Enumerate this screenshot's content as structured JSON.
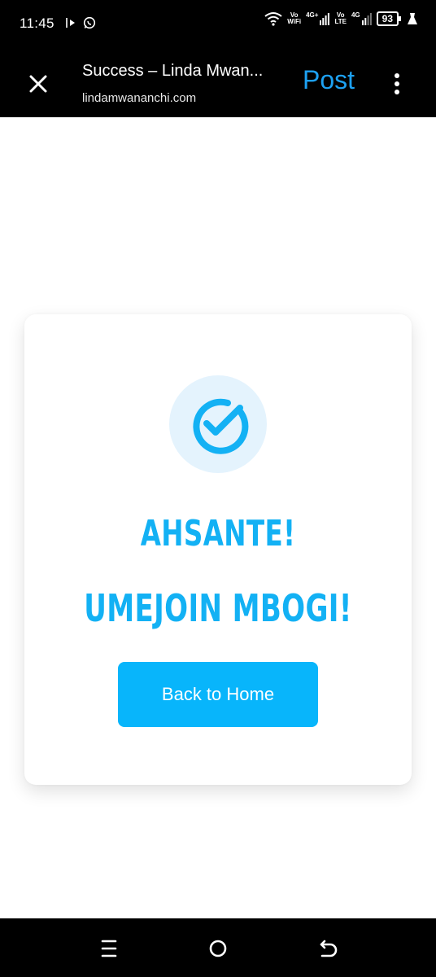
{
  "status_bar": {
    "time": "11:45",
    "vowifi_top": "Vo",
    "vowifi_bottom": "WiFi",
    "net1": "4G+",
    "volte_top": "Vo",
    "volte_bottom": "LTE",
    "net2": "4G",
    "battery": "93",
    "icons": [
      "cast-icon",
      "whatsapp-icon",
      "wifi-icon",
      "signal-icon",
      "signal-icon",
      "battery-icon",
      "bolt-icon"
    ]
  },
  "browser": {
    "title": "Success – Linda Mwan...",
    "url": "lindamwananchi.com",
    "post_label": "Post",
    "close_icon": "close-icon",
    "more_icon": "more-vertical-icon"
  },
  "card": {
    "icon": "check-circle-icon",
    "heading1": "AHSANTE!",
    "heading2": "UMEJOIN MBOGI!",
    "button_label": "Back to Home"
  },
  "nav": {
    "items": [
      "recent-apps-icon",
      "home-icon",
      "back-icon"
    ]
  },
  "colors": {
    "accent": "#13b1f4",
    "button": "#08b5fb",
    "post": "#1da1f2",
    "icon_bg": "#e4f3fd"
  }
}
